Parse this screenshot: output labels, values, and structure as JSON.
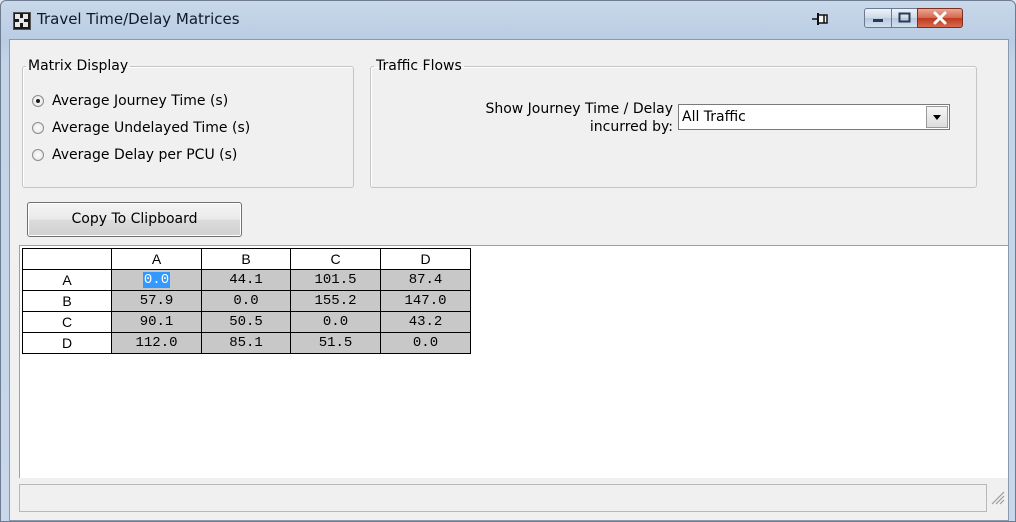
{
  "window": {
    "title": "Travel Time/Delay Matrices"
  },
  "matrix_display": {
    "legend": "Matrix Display",
    "options": [
      {
        "label": "Average Journey Time (s)",
        "checked": true
      },
      {
        "label": "Average Undelayed Time (s)",
        "checked": false
      },
      {
        "label": "Average Delay per PCU (s)",
        "checked": false
      }
    ]
  },
  "traffic_flows": {
    "legend": "Traffic Flows",
    "label_line1": "Show Journey Time / Delay",
    "label_line2": "incurred by:",
    "selected": "All Traffic"
  },
  "copy_button_label": "Copy To Clipboard",
  "matrix": {
    "columns": [
      "A",
      "B",
      "C",
      "D"
    ],
    "rows": [
      {
        "label": "A",
        "values": [
          "0.0",
          "44.1",
          "101.5",
          "87.4"
        ]
      },
      {
        "label": "B",
        "values": [
          "57.9",
          "0.0",
          "155.2",
          "147.0"
        ]
      },
      {
        "label": "C",
        "values": [
          "90.1",
          "50.5",
          "0.0",
          "43.2"
        ]
      },
      {
        "label": "D",
        "values": [
          "112.0",
          "85.1",
          "51.5",
          "0.0"
        ]
      }
    ],
    "selected_cell": "A-A"
  },
  "colors": {
    "selection": "#3399ff",
    "cell_background": "#c8c8c8",
    "close_button": "#c0391f"
  }
}
